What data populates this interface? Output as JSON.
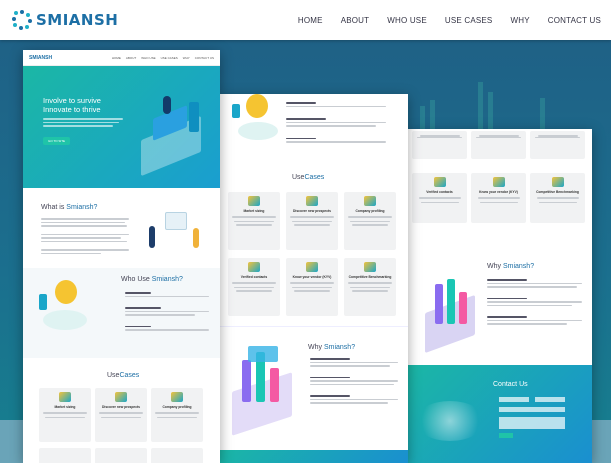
{
  "header": {
    "brand": "SMIANSH",
    "nav": [
      "HOME",
      "ABOUT",
      "WHO USE",
      "USE CASES",
      "WHY",
      "CONTACT US"
    ]
  },
  "mockup": {
    "hero_title_1": "Involve to survive",
    "hero_title_2": "Innovate to thrive",
    "hero_button": "GO TO SITE",
    "what_is": "What is",
    "who_use": "Who Use",
    "use": "Use",
    "cases": "Cases",
    "why": "Why",
    "brand_name": "Smiansh?",
    "contact": "Contact",
    "us": "Us",
    "cards": [
      "Market sizing",
      "Discover new prospects",
      "Company profiling",
      "Verified contacts",
      "Know your vendor (KYV)",
      "Competitive Benchmarking"
    ],
    "mini_links": [
      "HOME",
      "ABOUT",
      "WHO USE",
      "USE CASES",
      "WHY",
      "CONTACT US"
    ]
  },
  "colors": {
    "brand": "#1d6fa5",
    "accent": "#1fc4a8",
    "background": "#1d5f82"
  }
}
